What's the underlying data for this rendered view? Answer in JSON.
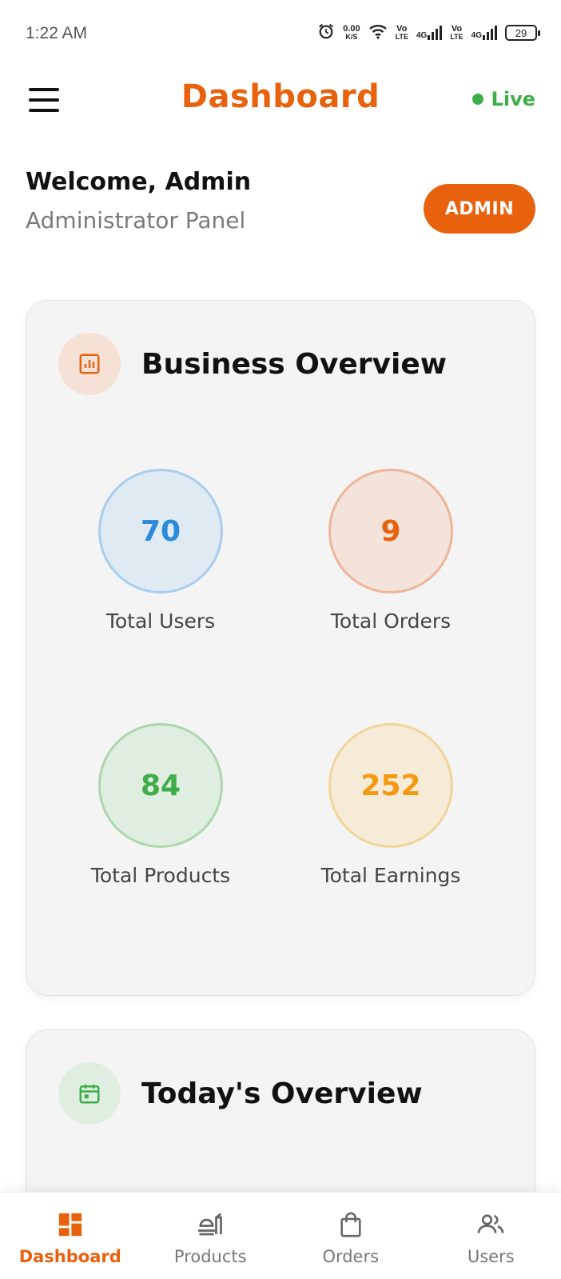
{
  "status_bar": {
    "time": "1:22 AM",
    "net_speed_value": "0.00",
    "net_speed_unit": "K/S",
    "sim1_vo": "Vo",
    "sim1_lte": "LTE",
    "sim1_gen": "4G",
    "sim2_vo": "Vo",
    "sim2_lte": "LTE",
    "sim2_gen": "4G",
    "battery": "29"
  },
  "app_bar": {
    "title": "Dashboard",
    "status_label": "Live",
    "status_color": "#3FAE4A"
  },
  "welcome": {
    "title": "Welcome, Admin",
    "subtitle": "Administrator Panel",
    "role_badge": "ADMIN"
  },
  "business_overview": {
    "title": "Business Overview",
    "icon": "chart-icon",
    "stats": [
      {
        "label": "Total Users",
        "value": "70",
        "color": "#2B8AD9"
      },
      {
        "label": "Total Orders",
        "value": "9",
        "color": "#E8620E"
      },
      {
        "label": "Total Products",
        "value": "84",
        "color": "#3FAE4A"
      },
      {
        "label": "Total Earnings",
        "value": "252",
        "color": "#F39A12"
      }
    ]
  },
  "todays_overview": {
    "title": "Today's Overview",
    "icon": "calendar-icon"
  },
  "bottom_nav": {
    "items": [
      {
        "label": "Dashboard",
        "icon": "dashboard-icon",
        "active": true
      },
      {
        "label": "Products",
        "icon": "food-icon",
        "active": false
      },
      {
        "label": "Orders",
        "icon": "shopping-bag-icon",
        "active": false
      },
      {
        "label": "Users",
        "icon": "users-icon",
        "active": false
      }
    ]
  },
  "colors": {
    "accent": "#E8620E",
    "card_bg": "#F4F4F4"
  }
}
